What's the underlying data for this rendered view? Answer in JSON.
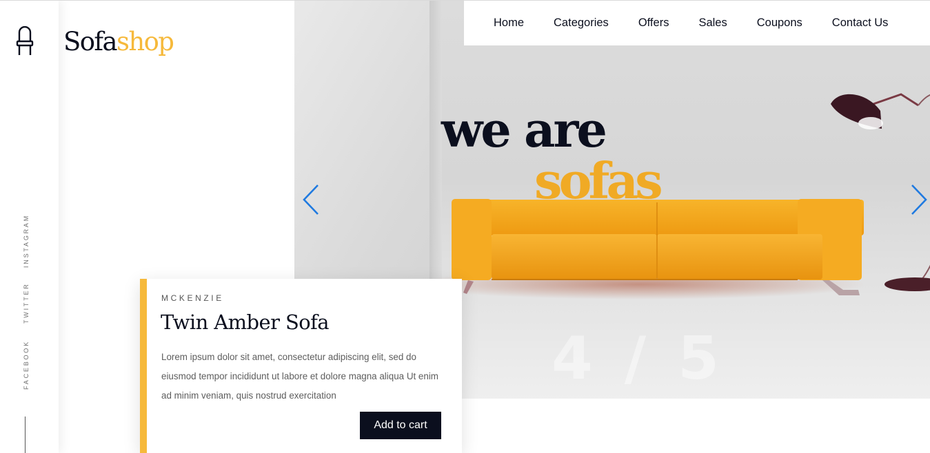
{
  "brand": {
    "logo_part1": "Sofa",
    "logo_part2": "shop"
  },
  "nav": [
    {
      "label": "Home"
    },
    {
      "label": "Categories"
    },
    {
      "label": "Offers"
    },
    {
      "label": "Sales"
    },
    {
      "label": "Coupons"
    },
    {
      "label": "Contact Us"
    }
  ],
  "social": {
    "instagram": "INSTAGRAM",
    "twitter": "TWITTER",
    "facebook": "FACEBOOK"
  },
  "hero": {
    "headline_line1": "we are",
    "headline_line2": "sofas",
    "slide_counter": "4 / 5"
  },
  "product": {
    "brand": "MCKENZIE",
    "title": "Twin Amber Sofa",
    "description": "Lorem ipsum dolor sit amet, consectetur adipiscing elit, sed do eiusmod tempor incididunt ut labore et dolore magna aliqua Ut enim ad minim veniam, quis nostrud exercitation",
    "cta_label": "Add to cart"
  },
  "colors": {
    "accent": "#f6b93b",
    "dark": "#0b0f1e",
    "arrow": "#1f7ae0",
    "sofa": "#f3a716"
  },
  "icons": {
    "logo_icon": "chair-icon",
    "prev": "chevron-left-icon",
    "next": "chevron-right-icon"
  }
}
